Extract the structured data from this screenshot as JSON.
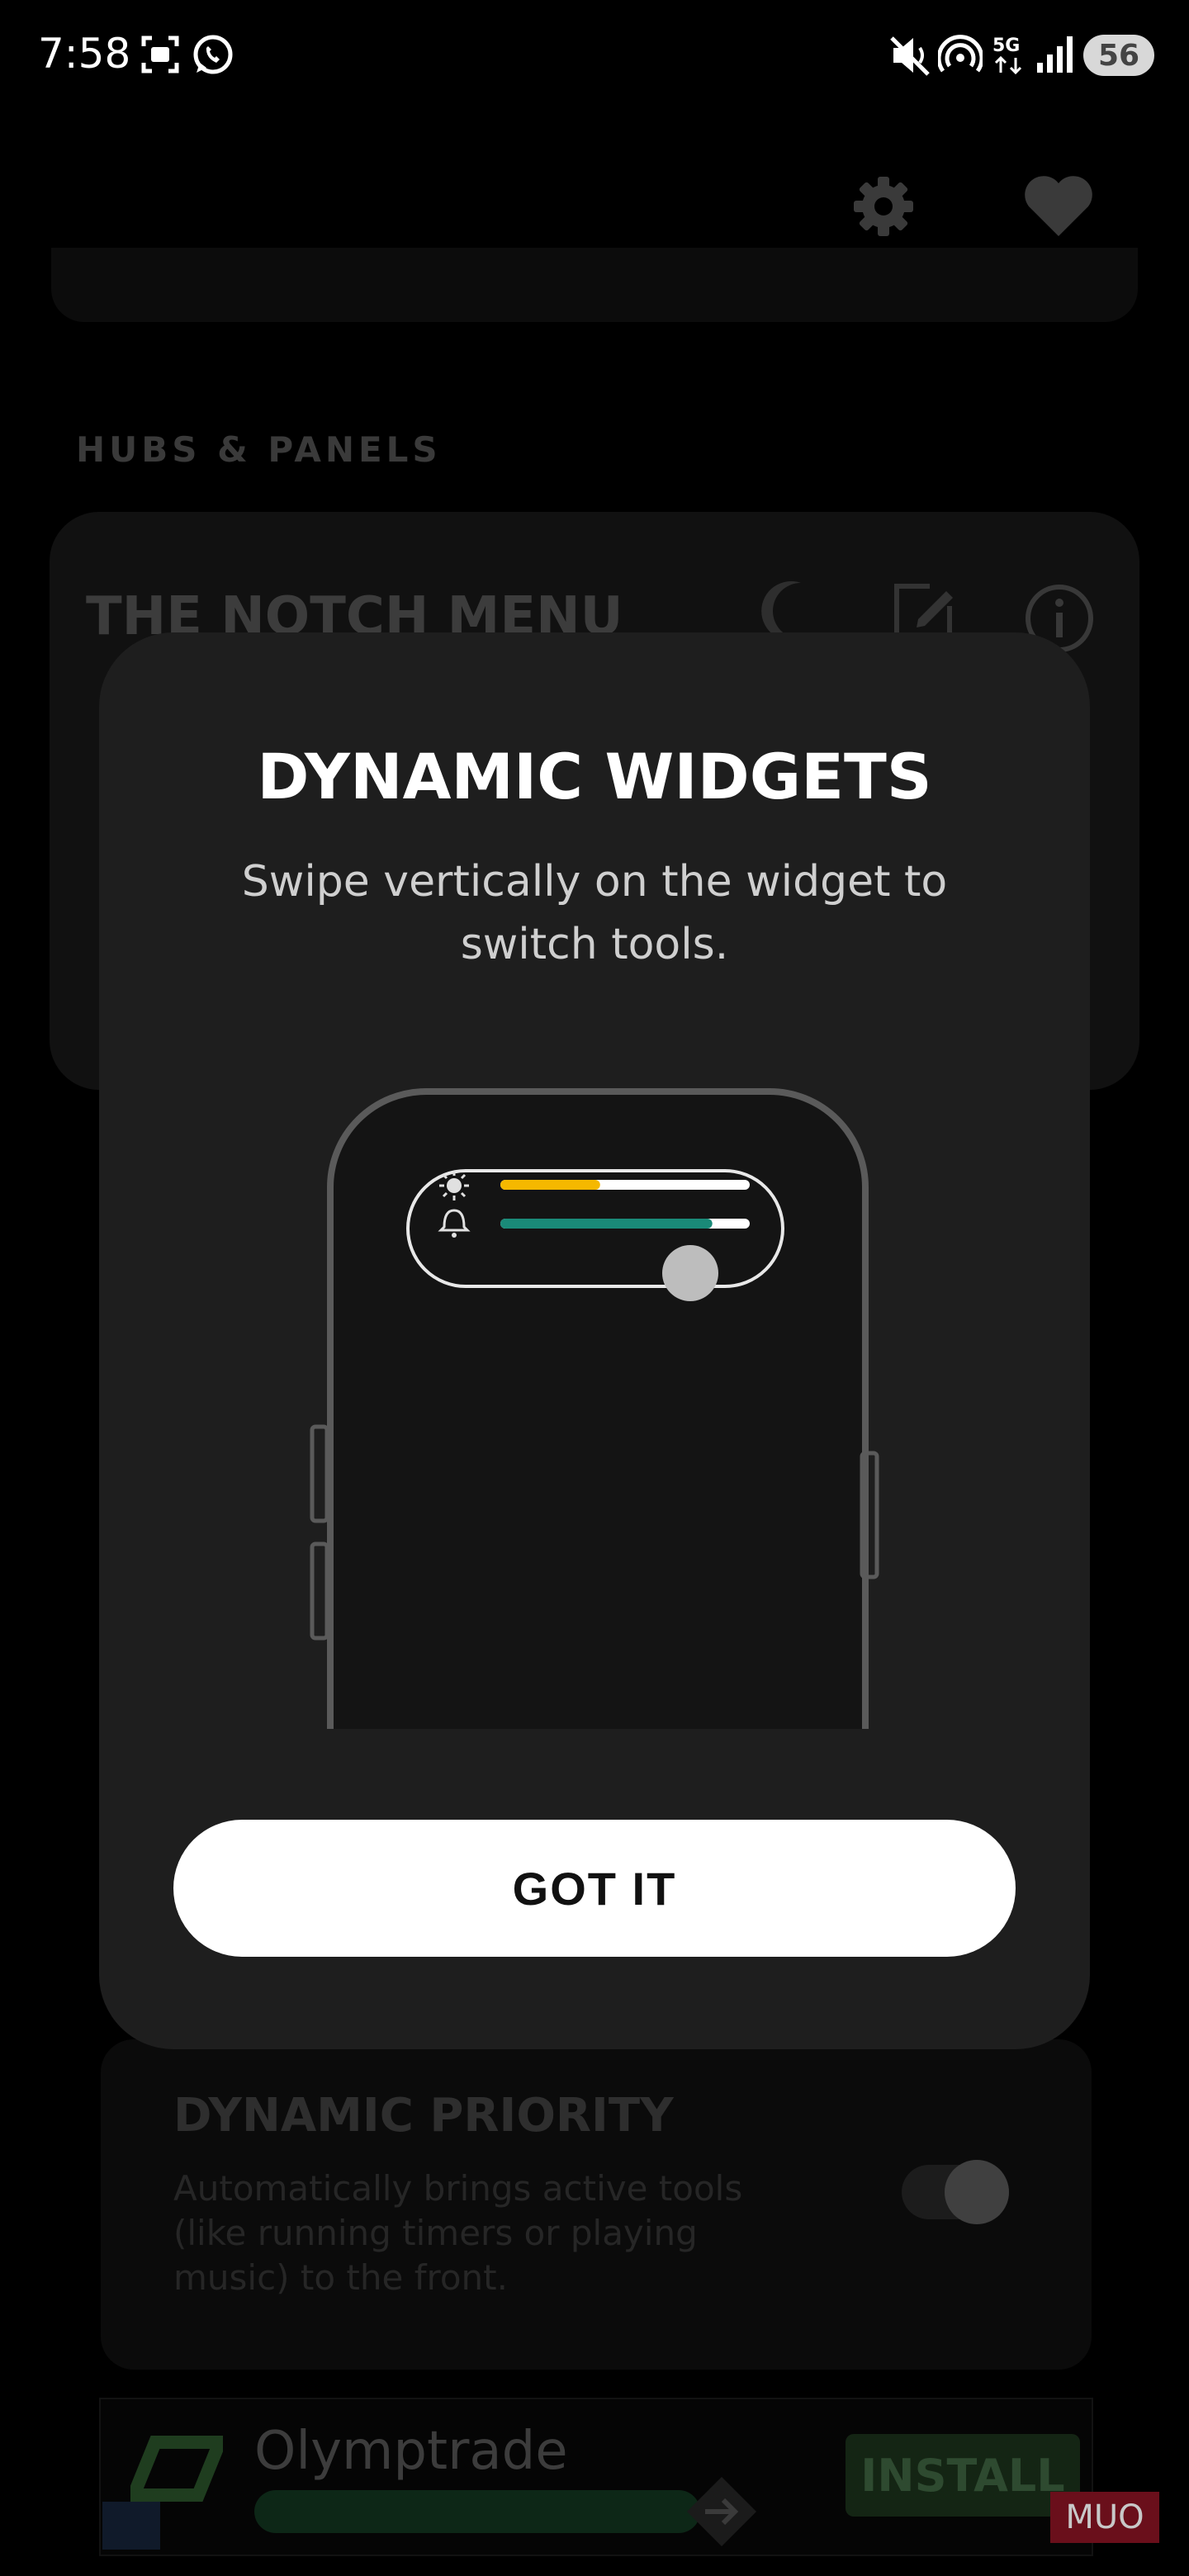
{
  "status_bar": {
    "time": "7:58",
    "battery": "56",
    "icons": [
      "screenshot-icon",
      "whatsapp-icon",
      "mute-icon",
      "hotspot-icon",
      "5g-icon",
      "signal-icon"
    ]
  },
  "header": {
    "icons": [
      "gear-icon",
      "heart-icon"
    ]
  },
  "background": {
    "section_label": "HUBS & PANELS",
    "notch_card_title": "THE NOTCH MENU",
    "notch_card_icons": [
      "moon-icon",
      "edit-icon",
      "info-icon"
    ],
    "priority_title": "DYNAMIC PRIORITY",
    "priority_desc": "Automatically brings active tools (like running timers or playing music) to the front."
  },
  "dialog": {
    "title": "DYNAMIC WIDGETS",
    "description": "Swipe vertically on the widget to switch tools.",
    "button_label": "GOT IT",
    "illustration": {
      "brightness_level": 0.4,
      "volume_level": 0.85,
      "accent_brightness": "#f5b800",
      "accent_volume": "#1a8a78"
    }
  },
  "ad": {
    "title": "Olymptrade",
    "install_label": "INSTALL",
    "watermark": "MUO"
  }
}
